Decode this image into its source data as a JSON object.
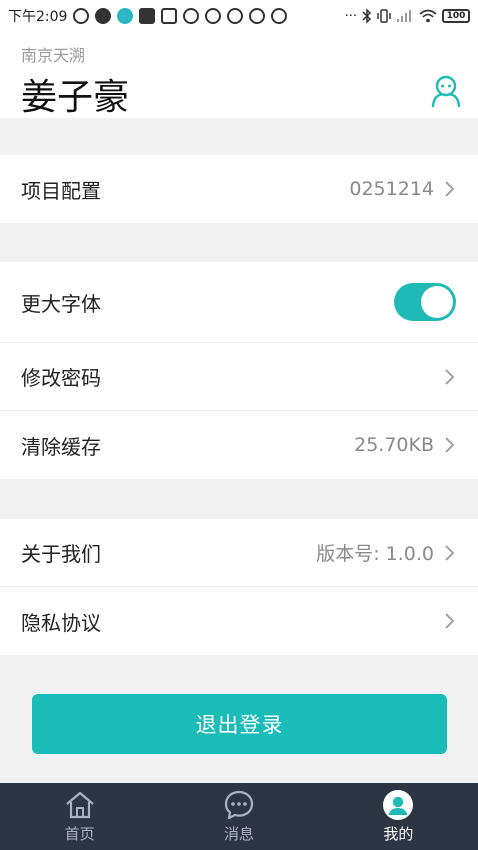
{
  "status_bar": {
    "time": "下午2:09",
    "dots": "···",
    "battery": "100"
  },
  "header": {
    "org": "南京天溯",
    "username": "姜子豪",
    "profile_icon": "profile-icon"
  },
  "settings": {
    "project_config": {
      "label": "项目配置",
      "value": "0251214"
    },
    "bigger_font": {
      "label": "更大字体",
      "enabled": true
    },
    "change_password": {
      "label": "修改密码"
    },
    "clear_cache": {
      "label": "清除缓存",
      "value": "25.70KB"
    },
    "about": {
      "label": "关于我们",
      "value": "版本号: 1.0.0"
    },
    "privacy": {
      "label": "隐私协议"
    }
  },
  "logout_label": "退出登录",
  "tabbar": {
    "items": [
      {
        "label": "首页",
        "icon": "home-icon",
        "active": false
      },
      {
        "label": "消息",
        "icon": "chat-icon",
        "active": false
      },
      {
        "label": "我的",
        "icon": "user-icon",
        "active": true
      }
    ]
  },
  "colors": {
    "accent": "#19bcb6",
    "tabbar_bg": "#2d3442"
  }
}
